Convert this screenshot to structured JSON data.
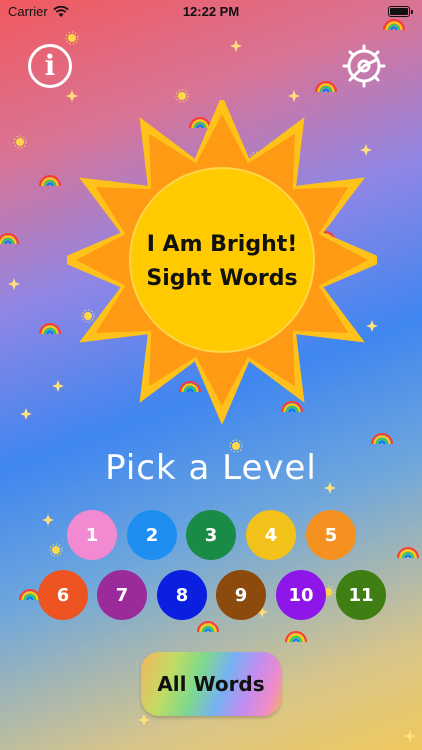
{
  "status_bar": {
    "carrier": "Carrier",
    "time": "12:22 PM"
  },
  "title": {
    "line1": "I Am Bright!",
    "line2": "Sight Words"
  },
  "level_prompt": "Pick a Level",
  "levels": [
    {
      "label": "1",
      "color": "#f28ad2"
    },
    {
      "label": "2",
      "color": "#1e8ff0"
    },
    {
      "label": "3",
      "color": "#1a8a47"
    },
    {
      "label": "4",
      "color": "#f3c21a"
    },
    {
      "label": "5",
      "color": "#f59120"
    },
    {
      "label": "6",
      "color": "#ee5422"
    },
    {
      "label": "7",
      "color": "#9b2a9a"
    },
    {
      "label": "8",
      "color": "#0b1fe0"
    },
    {
      "label": "9",
      "color": "#8c4a0c"
    },
    {
      "label": "10",
      "color": "#8e16e8"
    },
    {
      "label": "11",
      "color": "#3f7e12"
    }
  ],
  "all_words_label": "All Words",
  "icons": {
    "info": "info-icon",
    "settings": "gear-icon",
    "sun": "sun-graphic"
  }
}
